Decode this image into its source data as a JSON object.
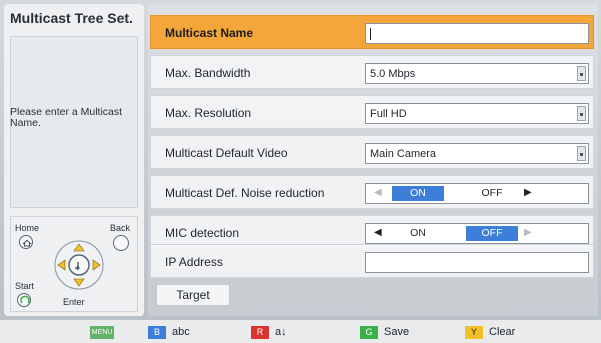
{
  "left": {
    "title": "Multicast Tree Set.",
    "message": "Please enter a Multicast Name."
  },
  "remote": {
    "home": "Home",
    "back": "Back",
    "start": "Start",
    "enter": "Enter"
  },
  "rows": [
    {
      "label": "Multicast Name",
      "value": ""
    },
    {
      "label": "Max. Bandwidth",
      "value": "5.0 Mbps"
    },
    {
      "label": "Max. Resolution",
      "value": "Full HD"
    },
    {
      "label": "Multicast Default Video",
      "value": "Main Camera"
    },
    {
      "label": "Multicast Def. Noise reduction",
      "on": "ON",
      "off": "OFF",
      "selected": "ON"
    },
    {
      "label": "MIC detection",
      "on": "ON",
      "off": "OFF",
      "selected": "OFF"
    },
    {
      "label": "IP Address",
      "value": ""
    }
  ],
  "target_label": "Target",
  "bottom": {
    "menu_key": "MENU",
    "b_key": "B",
    "b_label": "abc",
    "r_key": "R",
    "r_label": "a↓",
    "g_key": "G",
    "g_label": "Save",
    "y_key": "Y",
    "y_label": "Clear"
  },
  "colors": {
    "accent": "#f4a63a",
    "blue": "#3d7fd8",
    "red": "#d9342f",
    "green": "#3fae4a",
    "yellow": "#f2c028",
    "menu": "#63b26a"
  }
}
